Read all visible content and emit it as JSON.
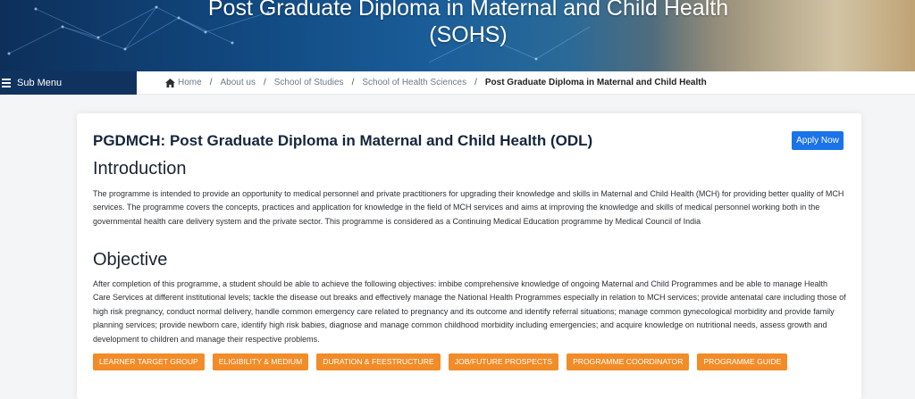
{
  "banner": {
    "title_line1": "Post Graduate Diploma in Maternal and Child Health",
    "title_line2": "(SOHS)"
  },
  "submenu": {
    "label": "Sub Menu",
    "icon": "menu-icon"
  },
  "breadcrumb": {
    "items": [
      "Home",
      "About us",
      "School of Studies",
      "School of Health Sciences"
    ],
    "current": "Post Graduate Diploma in Maternal and Child Health",
    "separator": "/",
    "home_icon": "home-icon"
  },
  "main": {
    "heading": "PGDMCH: Post Graduate Diploma in Maternal and Child Health (ODL)",
    "apply_label": "Apply Now",
    "intro_title": "Introduction",
    "intro_text": "The programme is intended to provide an opportunity to medical personnel and private practitioners for upgrading their knowledge and skills in Maternal and Child Health (MCH) for providing better quality of MCH services. The programme covers the concepts, practices and application for knowledge in the field of MCH services and aims at improving the knowledge and skills of medical personnel working both in the governmental health care delivery system and the private sector. This programme is considered as a Continuing Medical Education programme by Medical Council of India",
    "objective_title": "Objective",
    "objective_text": "After completion of this programme, a student should be able to achieve the following objectives: imbibe comprehensive knowledge of ongoing Maternal and Child Programmes and be able to manage Health Care Services at different institutional levels; tackle the disease out breaks and effectively manage the National Health Programmes especially in relation to MCH services; provide antenatal care including those of high risk pregnancy, conduct normal delivery, handle common emergency care related to pregnancy and its outcome and identify referral situations; manage common gynecological morbidity and provide family planning services; provide newborn care, identify high risk babies, diagnose and manage common childhood morbidity including emergencies; and acquire knowledge on nutritional needs, assess growth and development to children and manage their respective problems.",
    "buttons": [
      "LEARNER TARGET GROUP",
      "ELIGIBILITY & MEDIUM",
      "DURATION & FEESTRUCTURE",
      "JOB/FUTURE PROSPECTS",
      "PROGRAMME COORDINATOR",
      "PROGRAMME GUIDE"
    ]
  },
  "colors": {
    "banner_navy": "#10325f",
    "apply_blue": "#1a73e8",
    "tag_orange": "#f28c28",
    "heading_dark": "#15263c"
  }
}
